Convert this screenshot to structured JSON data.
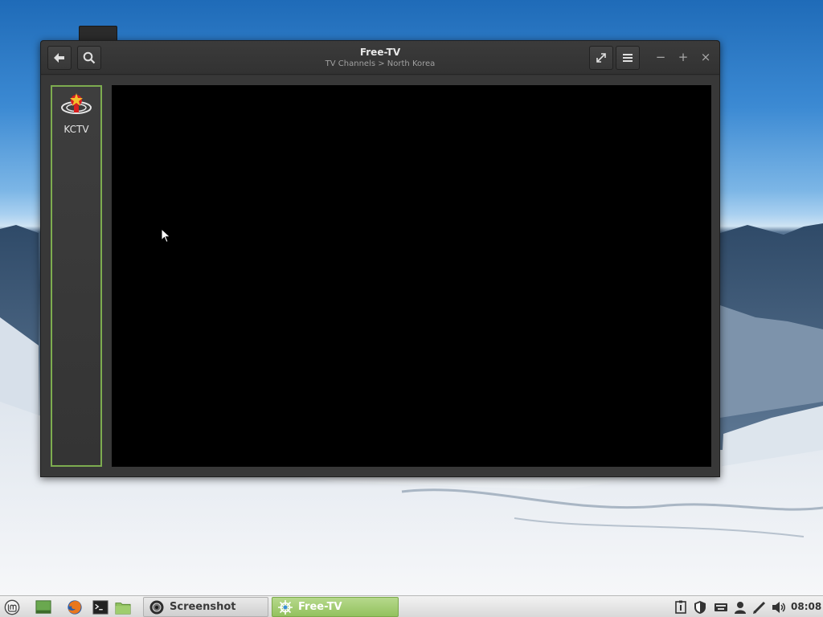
{
  "window": {
    "title": "Free-TV",
    "subtitle": "TV Channels > North Korea",
    "buttons": {
      "back": "arrow-left-icon",
      "search": "search-icon",
      "fullscreen": "fullscreen-icon",
      "menu": "hamburger-menu-icon",
      "minimize_label": "−",
      "maximize_label": "+",
      "close_label": "×"
    }
  },
  "channels": [
    {
      "name": "KCTV",
      "selected": true
    }
  ],
  "colors": {
    "selection_border": "#7dac4f",
    "active_task": "#9bc866",
    "video_background": "#000000"
  },
  "taskbar": {
    "launchers": [
      "mint-menu-icon",
      "show-desktop-icon",
      "firefox-icon",
      "terminal-icon",
      "files-icon"
    ],
    "tasks": [
      {
        "label": "Screenshot",
        "active": false
      },
      {
        "label": "Free-TV",
        "active": true
      }
    ],
    "tray": [
      "update-manager-icon",
      "shield-icon",
      "keyboard-icon",
      "user-icon",
      "pen-icon",
      "volume-icon"
    ],
    "clock": "08:08"
  }
}
